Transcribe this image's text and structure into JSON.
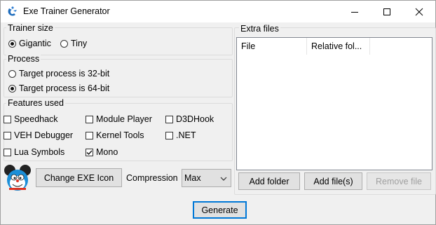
{
  "window": {
    "title": "Exe Trainer Generator",
    "icon": "cheat-engine-icon"
  },
  "trainer_size": {
    "legend": "Trainer size",
    "options": [
      {
        "label": "Gigantic",
        "selected": true
      },
      {
        "label": "Tiny",
        "selected": false
      }
    ]
  },
  "process": {
    "legend": "Process",
    "options": [
      {
        "label": "Target process is 32-bit",
        "selected": false
      },
      {
        "label": "Target process is 64-bit",
        "selected": true
      }
    ]
  },
  "features": {
    "legend": "Features used",
    "items": [
      {
        "label": "Speedhack",
        "checked": false
      },
      {
        "label": "Module Player",
        "checked": false
      },
      {
        "label": "D3DHook",
        "checked": false
      },
      {
        "label": "VEH Debugger",
        "checked": false
      },
      {
        "label": "Kernel Tools",
        "checked": false
      },
      {
        "label": ".NET",
        "checked": false
      },
      {
        "label": "Lua Symbols",
        "checked": false
      },
      {
        "label": "Mono",
        "checked": true
      }
    ]
  },
  "icon_row": {
    "change_icon_label": "Change EXE Icon",
    "compression_label": "Compression",
    "compression_value": "Max"
  },
  "extra_files": {
    "legend": "Extra files",
    "columns": [
      "File",
      "Relative fol..."
    ],
    "add_folder": "Add folder",
    "add_files": "Add file(s)",
    "remove_file": "Remove file"
  },
  "generate_label": "Generate"
}
